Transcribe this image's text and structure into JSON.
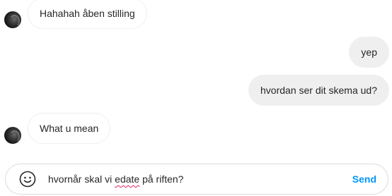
{
  "messages": [
    {
      "direction": "in",
      "text": "Hahahah åben stilling",
      "has_avatar": true
    },
    {
      "direction": "out",
      "text": "yep"
    },
    {
      "direction": "out",
      "text": "hvordan ser dit skema ud?"
    },
    {
      "direction": "in",
      "text": "What u mean",
      "has_avatar": true
    }
  ],
  "composer": {
    "text_before": "hvornår skal vi ",
    "text_misspelled": "edate",
    "text_after": " på riften?",
    "emoji_icon": "smiley-face-icon",
    "send_label": "Send"
  },
  "colors": {
    "send": "#0095f6",
    "outgoing_bubble": "#efefef",
    "incoming_border": "#efefef",
    "spellcheck_underline": "#e0245e"
  }
}
